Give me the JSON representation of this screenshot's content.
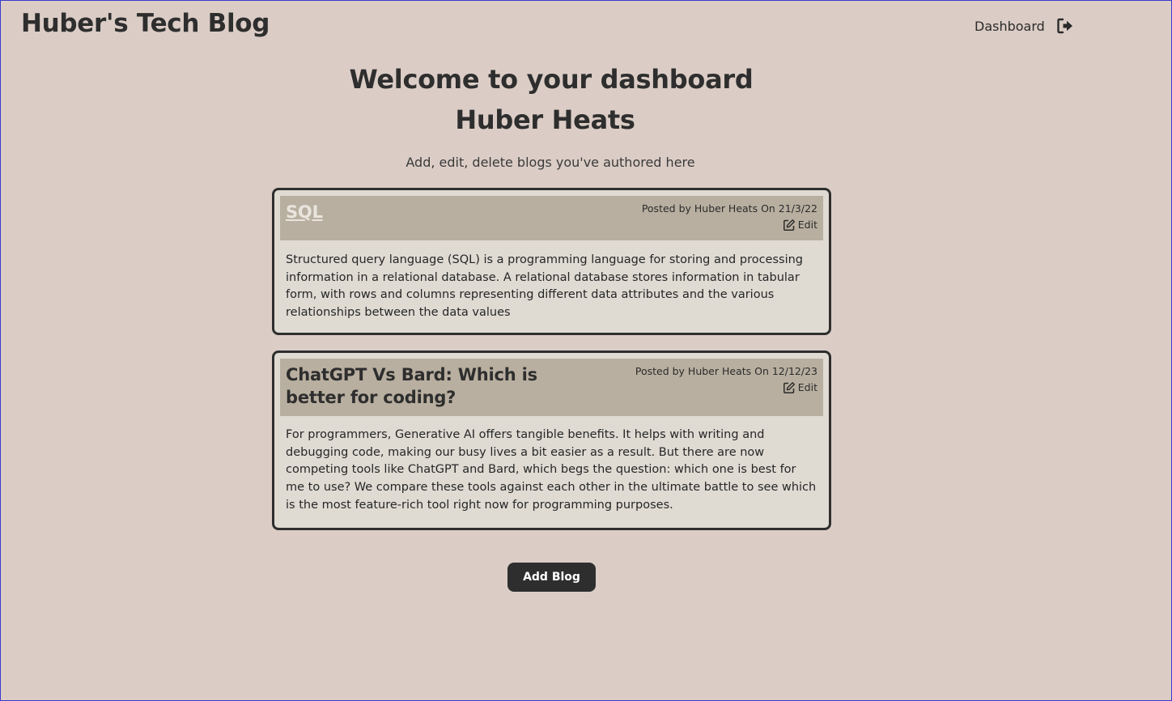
{
  "header": {
    "site_title": "Huber's Tech Blog",
    "nav_dashboard": "Dashboard",
    "logout_icon": "sign-out-icon"
  },
  "main": {
    "welcome": "Welcome to your dashboard",
    "username": "Huber Heats",
    "subtitle": "Add, edit, delete blogs you've authored here"
  },
  "posts": [
    {
      "title": "SQL",
      "meta": "Posted by Huber Heats On 21/3/22",
      "edit_label": "Edit",
      "body": "Structured query language (SQL) is a programming language for storing and processing information in a relational database. A relational database stores information in tabular form, with rows and columns representing different data attributes and the various relationships between the data values"
    },
    {
      "title": "ChatGPT Vs Bard: Which is better for coding?",
      "meta": "Posted by Huber Heats On 12/12/23",
      "edit_label": "Edit",
      "body": "For programmers, Generative AI offers tangible benefits. It helps with writing and debugging code, making our busy lives a bit easier as a result. But there are now competing tools like ChatGPT and Bard, which begs the question: which one is best for me to use? We compare these tools against each other in the ultimate battle to see which is the most feature-rich tool right now for programming purposes."
    }
  ],
  "actions": {
    "add_blog": "Add Blog"
  },
  "colors": {
    "background": "#dbcdc6",
    "card_header": "#b8afa0",
    "card_body": "#dfdbd3",
    "button": "#2e2e2e"
  }
}
